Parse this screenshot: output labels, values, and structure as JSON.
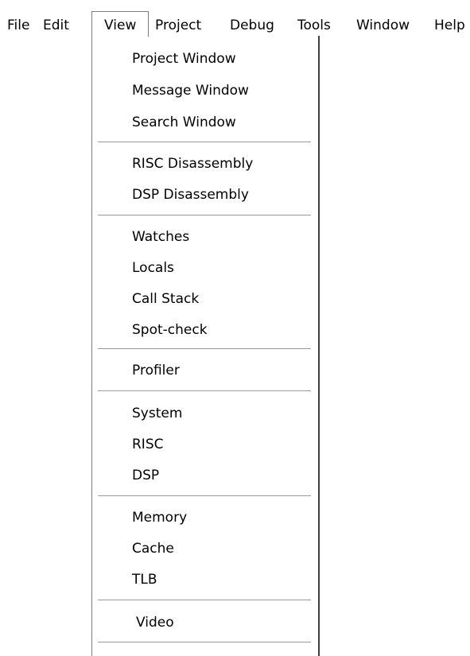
{
  "menubar": {
    "items": [
      {
        "label": "File"
      },
      {
        "label": "Edit"
      },
      {
        "label": "View"
      },
      {
        "label": "Project"
      },
      {
        "label": "Debug"
      },
      {
        "label": "Tools"
      },
      {
        "label": "Window"
      },
      {
        "label": "Help"
      }
    ],
    "open_item": "View"
  },
  "view_menu": {
    "entries": [
      {
        "label": "Project  Window"
      },
      {
        "label": "Message Window"
      },
      {
        "label": "Search Window"
      },
      {
        "label": "RISC Disassembly"
      },
      {
        "label": "DSP Disassembly"
      },
      {
        "label": "Watches"
      },
      {
        "label": "Locals"
      },
      {
        "label": "Call Stack"
      },
      {
        "label": "Spot-check"
      },
      {
        "label": "Profiler"
      },
      {
        "label": "System"
      },
      {
        "label": "RISC"
      },
      {
        "label": "DSP"
      },
      {
        "label": "Memory"
      },
      {
        "label": "Cache"
      },
      {
        "label": "TLB"
      },
      {
        "label": "Video"
      }
    ]
  }
}
